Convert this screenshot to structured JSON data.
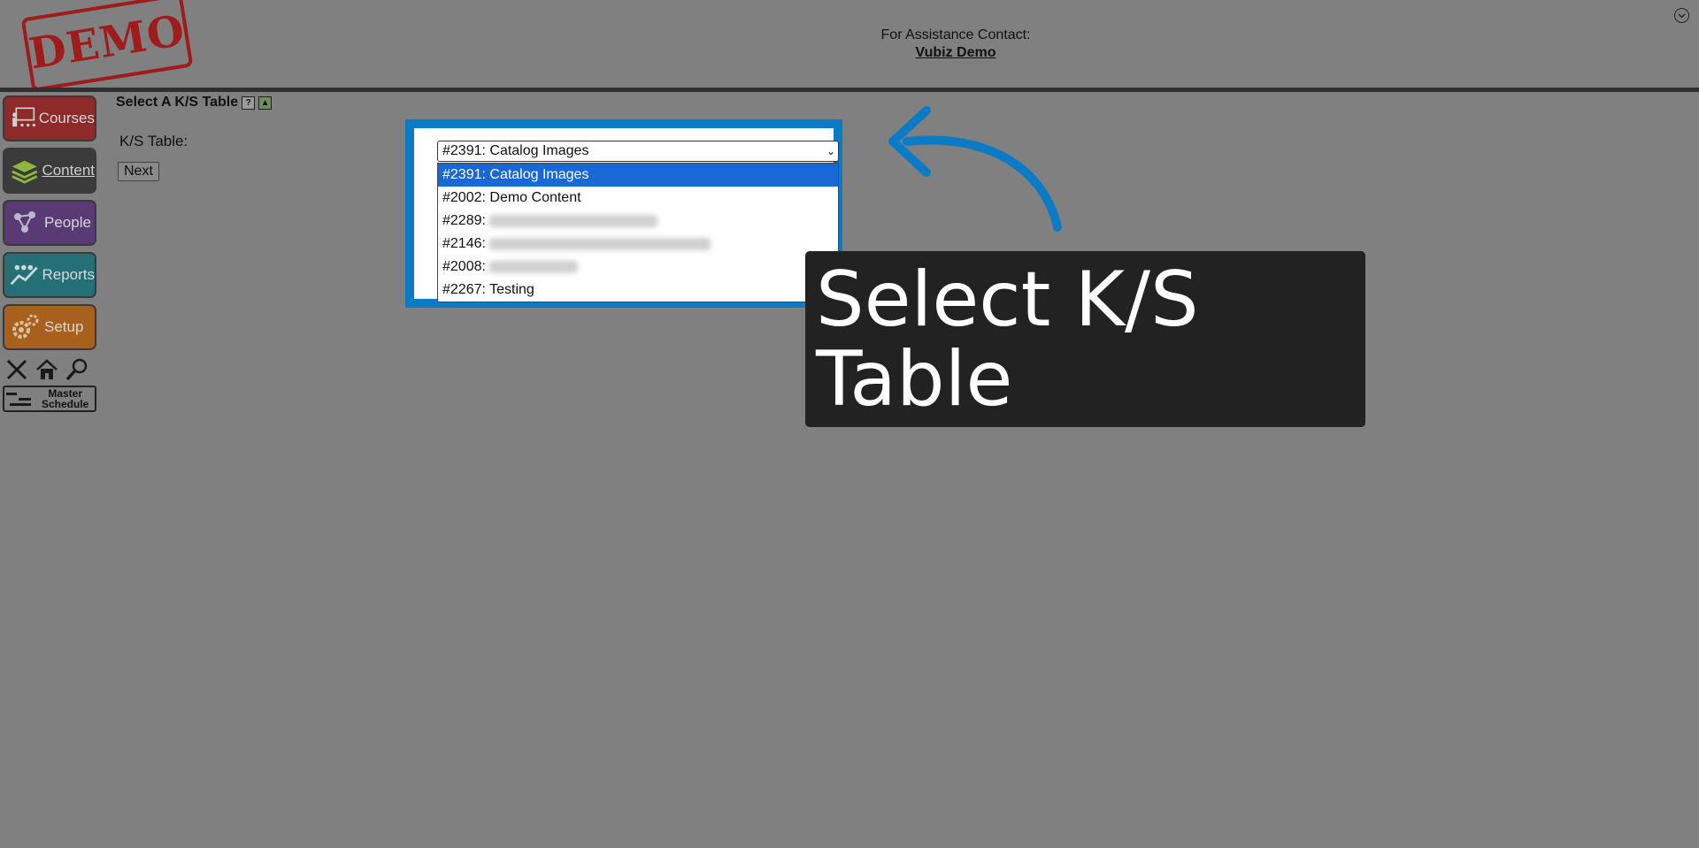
{
  "header": {
    "stamp": "DEMO",
    "assist_label": "For Assistance Contact:",
    "assist_link": "Vubiz Demo"
  },
  "sidebar": {
    "items": [
      {
        "label": "Courses",
        "icon": "courses-icon"
      },
      {
        "label": "Content",
        "icon": "content-icon"
      },
      {
        "label": "People",
        "icon": "people-icon"
      },
      {
        "label": "Reports",
        "icon": "reports-icon"
      },
      {
        "label": "Setup",
        "icon": "setup-icon"
      }
    ],
    "tools": [
      "close-icon",
      "home-icon",
      "search-icon"
    ],
    "master_schedule": "Master\nSchedule"
  },
  "main": {
    "title": "Select A K/S Table",
    "field_label": "K/S Table:",
    "next_button": "Next",
    "select_value": "#2391: Catalog Images",
    "options": [
      {
        "text": "#2391: Catalog Images",
        "selected": true
      },
      {
        "text": "#2002: Demo Content",
        "selected": false
      },
      {
        "text": "#2289:",
        "selected": false
      },
      {
        "text": "#2146:",
        "selected": false
      },
      {
        "text": "#2008:",
        "selected": false
      },
      {
        "text": "#2267: Testing",
        "selected": false
      }
    ]
  },
  "callout": {
    "text": "Select K/S Table",
    "color": "#0a7bc4"
  },
  "colors": {
    "background": "#808080",
    "highlight": "#0a7bc4",
    "selected_option": "#1a67d6",
    "callout_bg": "#222222"
  }
}
